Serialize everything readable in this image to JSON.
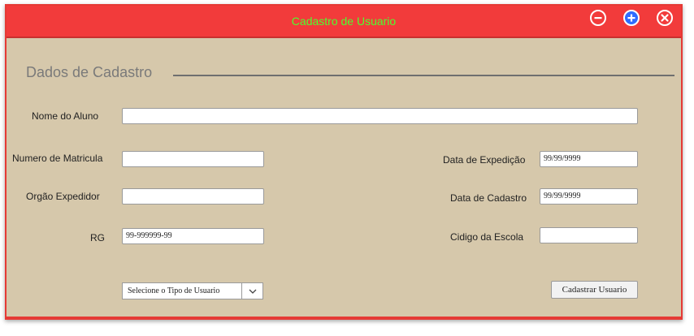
{
  "window": {
    "title": "Cadastro de Usuario",
    "title_color": "#4cff2f",
    "titlebar_color": "#f23b3b",
    "background_color": "#d6c8ab",
    "controls": [
      "minus-circle-icon",
      "plus-circle-icon",
      "close-circle-icon"
    ]
  },
  "section": {
    "title": "Dados de Cadastro"
  },
  "form": {
    "nome_label": "Nome do Aluno",
    "nome_value": "",
    "matricula_label": "Numero de Matricula",
    "matricula_value": "",
    "orgao_label": "Orgão Expedidor",
    "orgao_value": "",
    "rg_label": "RG",
    "rg_value": "99-999999-99",
    "data_expedicao_label": "Data de Expedição",
    "data_expedicao_value": "99/99/9999",
    "data_cadastro_label": "Data de Cadastro",
    "data_cadastro_value": "99/99/9999",
    "codigo_escola_label": "Cidigo da Escola",
    "codigo_escola_value": "",
    "tipo_usuario_select": "Selecione o Tipo de Usuario",
    "submit_label": "Cadastrar Usuario"
  }
}
